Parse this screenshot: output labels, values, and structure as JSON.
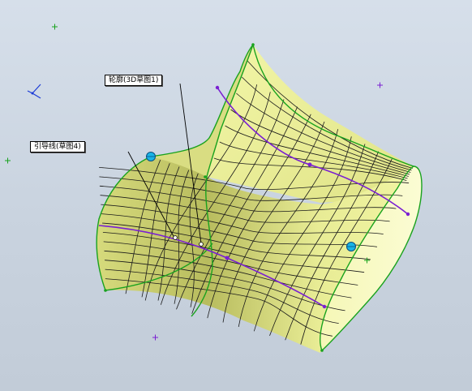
{
  "callouts": {
    "profile": "轮廓(3D草图1)",
    "guide": "引导线(草图4)"
  },
  "colors": {
    "surface": "#eef29a",
    "surface_shade": "#b9bd5e",
    "mesh": "#1a1a1a",
    "edge": "#19a21e",
    "guide": "#7a1fd2",
    "point": "#18b4e6",
    "background": "#cfd8e3"
  },
  "icons": [
    "triad-icon",
    "sketch-origin-icon",
    "handle-icon",
    "sketch-point-icon"
  ]
}
